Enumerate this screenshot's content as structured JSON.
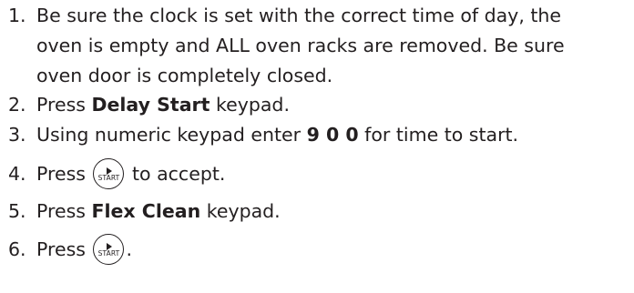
{
  "steps": [
    {
      "number": "1.",
      "lines": [
        "Be sure the clock is set with the correct time of day, the",
        "oven is empty and ALL oven racks are removed. Be sure",
        "oven door is completely closed."
      ]
    },
    {
      "number": "2.",
      "prefix": "Press ",
      "bold": "Delay Start",
      "suffix": " keypad."
    },
    {
      "number": "3.",
      "prefix": "Using numeric keypad enter ",
      "bold": "9 0 0",
      "suffix": " for time to start."
    },
    {
      "number": "4.",
      "prefix": "Press ",
      "key_label": "START",
      "suffix": " to accept."
    },
    {
      "number": "5.",
      "prefix": "Press ",
      "bold": "Flex Clean",
      "suffix": " keypad."
    },
    {
      "number": "6.",
      "prefix": "Press ",
      "key_label": "START",
      "suffix": "."
    }
  ]
}
